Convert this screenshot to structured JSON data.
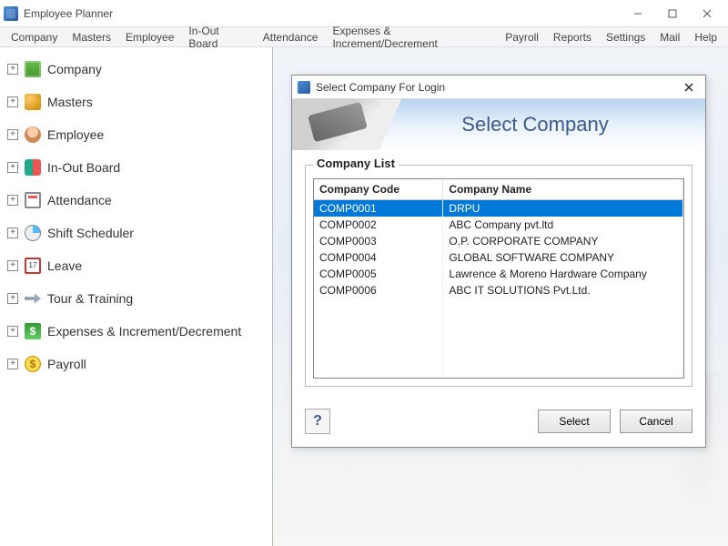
{
  "app": {
    "title": "Employee Planner"
  },
  "menus": [
    "Company",
    "Masters",
    "Employee",
    "In-Out Board",
    "Attendance",
    "Expenses & Increment/Decrement",
    "Payroll",
    "Reports",
    "Settings",
    "Mail",
    "Help"
  ],
  "sidebar": {
    "items": [
      {
        "label": "Company",
        "icon": "company-icon"
      },
      {
        "label": "Masters",
        "icon": "masters-icon"
      },
      {
        "label": "Employee",
        "icon": "employee-icon"
      },
      {
        "label": "In-Out Board",
        "icon": "inout-icon"
      },
      {
        "label": "Attendance",
        "icon": "attendance-icon"
      },
      {
        "label": "Shift Scheduler",
        "icon": "shift-icon"
      },
      {
        "label": "Leave",
        "icon": "leave-icon"
      },
      {
        "label": "Tour & Training",
        "icon": "tour-icon"
      },
      {
        "label": "Expenses & Increment/Decrement",
        "icon": "expenses-icon"
      },
      {
        "label": "Payroll",
        "icon": "payroll-icon"
      }
    ]
  },
  "dialog": {
    "title": "Select Company For Login",
    "banner_title": "Select Company",
    "group_label": "Company List",
    "columns": [
      "Company Code",
      "Company Name"
    ],
    "rows": [
      {
        "code": "COMP0001",
        "name": "DRPU",
        "selected": true
      },
      {
        "code": "COMP0002",
        "name": "ABC Company pvt.ltd"
      },
      {
        "code": "COMP0003",
        "name": "O.P. CORPORATE COMPANY"
      },
      {
        "code": "COMP0004",
        "name": "GLOBAL SOFTWARE COMPANY"
      },
      {
        "code": "COMP0005",
        "name": "Lawrence & Moreno Hardware Company"
      },
      {
        "code": "COMP0006",
        "name": "ABC IT SOLUTIONS Pvt.Ltd."
      }
    ],
    "buttons": {
      "help": "?",
      "select": "Select",
      "cancel": "Cancel"
    }
  }
}
